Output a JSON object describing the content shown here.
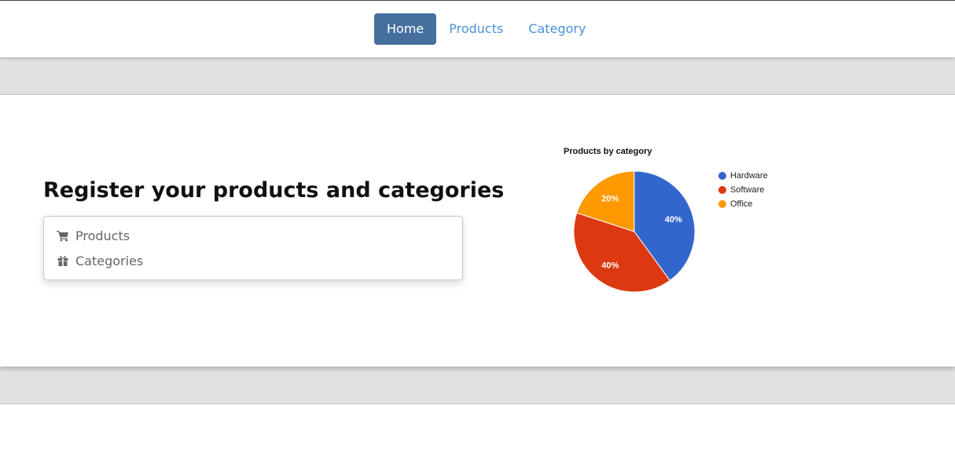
{
  "nav": {
    "items": [
      {
        "label": "Home",
        "active": true
      },
      {
        "label": "Products",
        "active": false
      },
      {
        "label": "Category",
        "active": false
      }
    ],
    "active_color": "#45709e",
    "link_color": "#4a90d9"
  },
  "main": {
    "heading": "Register your products and categories",
    "links": [
      {
        "label": "Products",
        "icon": "shopping-cart-icon"
      },
      {
        "label": "Categories",
        "icon": "gift-icon"
      }
    ]
  },
  "chart_data": {
    "type": "pie",
    "title": "Products by category",
    "slices": [
      {
        "label": "Hardware",
        "value": 40,
        "display": "40%",
        "color": "#3366cc"
      },
      {
        "label": "Software",
        "value": 40,
        "display": "40%",
        "color": "#dc3912"
      },
      {
        "label": "Office",
        "value": 20,
        "display": "20%",
        "color": "#ff9900"
      }
    ],
    "legend_position": "right"
  }
}
